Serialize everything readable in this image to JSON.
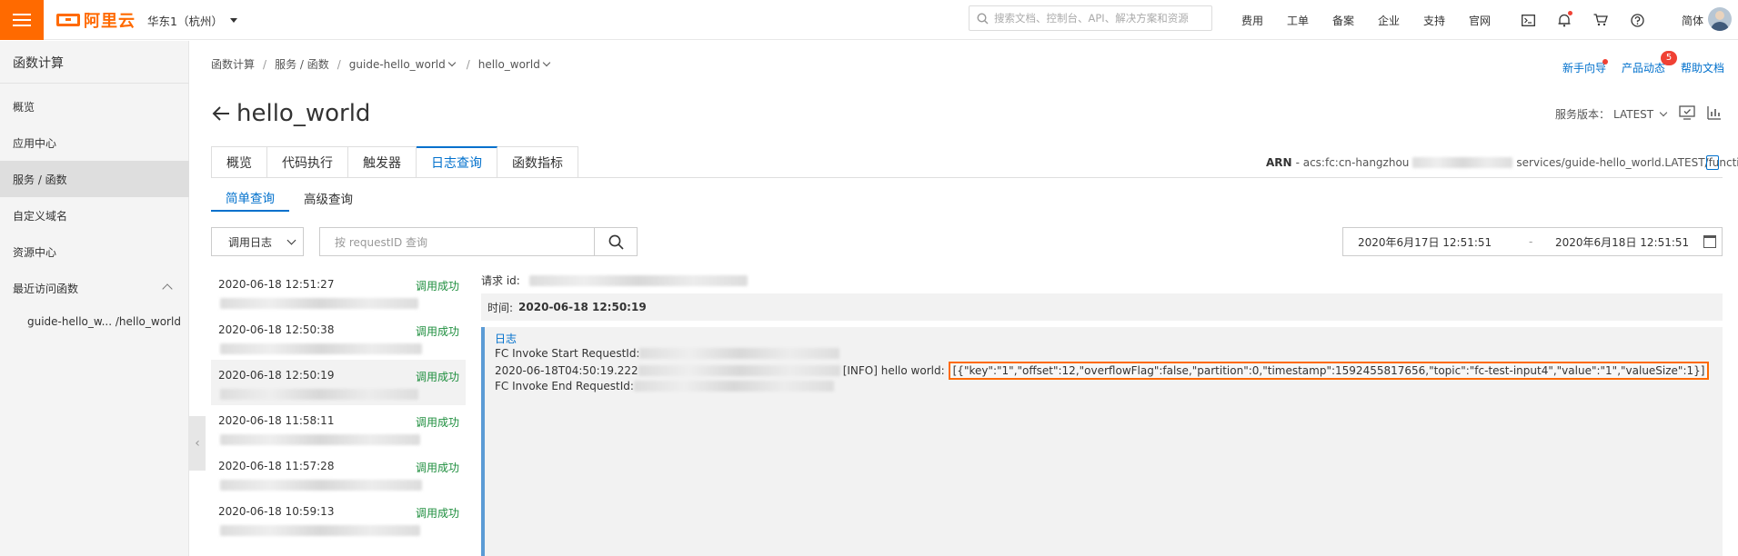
{
  "topbar": {
    "brand": "阿里云",
    "region": "华东1（杭州）",
    "search_placeholder": "搜索文档、控制台、API、解决方案和资源",
    "links": [
      "费用",
      "工单",
      "备案",
      "企业",
      "支持",
      "官网"
    ],
    "lang": "简体"
  },
  "sidebar": {
    "title": "函数计算",
    "items": [
      {
        "label": "概览"
      },
      {
        "label": "应用中心"
      },
      {
        "label": "服务 / 函数"
      },
      {
        "label": "自定义域名"
      },
      {
        "label": "资源中心"
      },
      {
        "label": "最近访问函数"
      }
    ],
    "recent": "guide-hello_w... /hello_world"
  },
  "breadcrumb": {
    "items": [
      "函数计算",
      "服务 / 函数",
      "guide-hello_world",
      "hello_world"
    ]
  },
  "help": {
    "guide": "新手向导",
    "news": "产品动态",
    "news_badge": "5",
    "docs": "帮助文档"
  },
  "function": {
    "title": "hello_world",
    "version_label": "服务版本：",
    "version_value": "LATEST",
    "arn_label": "ARN",
    "arn_prefix": "- acs:fc:cn-hangzhou",
    "arn_suffix": "services/guide-hello_world.LATEST/functio..."
  },
  "tabs": [
    "概览",
    "代码执行",
    "触发器",
    "日志查询",
    "函数指标"
  ],
  "subtabs": [
    "简单查询",
    "高级查询"
  ],
  "filters": {
    "log_type": "调用日志",
    "request_placeholder": "按 requestID 查询",
    "date_start": "2020年6月17日 12:51:51",
    "date_sep": "-",
    "date_end": "2020年6月18日 12:51:51"
  },
  "log_list": [
    {
      "time": "2020-06-18 12:51:27",
      "status": "调用成功"
    },
    {
      "time": "2020-06-18 12:50:38",
      "status": "调用成功"
    },
    {
      "time": "2020-06-18 12:50:19",
      "status": "调用成功"
    },
    {
      "time": "2020-06-18 11:58:11",
      "status": "调用成功"
    },
    {
      "time": "2020-06-18 11:57:28",
      "status": "调用成功"
    },
    {
      "time": "2020-06-18 10:59:13",
      "status": "调用成功"
    }
  ],
  "detail": {
    "request_label": "请求 id:",
    "time_label": "时间:",
    "time_value": "2020-06-18 12:50:19",
    "log_label": "日志",
    "line1": "FC Invoke Start RequestId:",
    "line2_prefix": "2020-06-18T04:50:19.222",
    "line2_level": "[INFO] hello world:",
    "line2_payload": "[{\"key\":\"1\",\"offset\":12,\"overflowFlag\":false,\"partition\":0,\"timestamp\":1592455817656,\"topic\":\"fc-test-input4\",\"value\":\"1\",\"valueSize\":1}]",
    "line3": "FC Invoke End RequestId:"
  }
}
